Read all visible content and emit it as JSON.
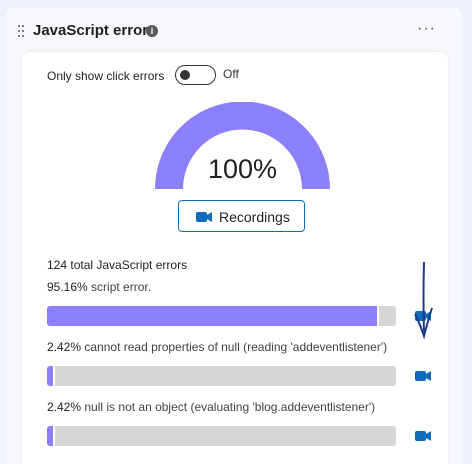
{
  "widget": {
    "title": "JavaScript errors",
    "more_label": "···"
  },
  "toggle": {
    "label": "Only show click errors",
    "state": "Off",
    "on": false
  },
  "gauge": {
    "value_label": "100%",
    "fraction": 1.0,
    "color": "#8b80f9"
  },
  "recordings_button": {
    "label": "Recordings"
  },
  "summary": {
    "total_label": "124 total JavaScript errors"
  },
  "errors": [
    {
      "percent": "95.16%",
      "message": "script error.",
      "fill": 0.9516
    },
    {
      "percent": "2.42%",
      "message": "cannot read properties of null (reading 'addeventlistener')",
      "fill": 0.0242
    },
    {
      "percent": "2.42%",
      "message": "null is not an object (evaluating 'blog.addeventlistener')",
      "fill": 0.0242
    }
  ],
  "colors": {
    "accent": "#0f6cbd",
    "bar_fill": "#8b80f9",
    "bar_track": "#d6d6d6"
  }
}
